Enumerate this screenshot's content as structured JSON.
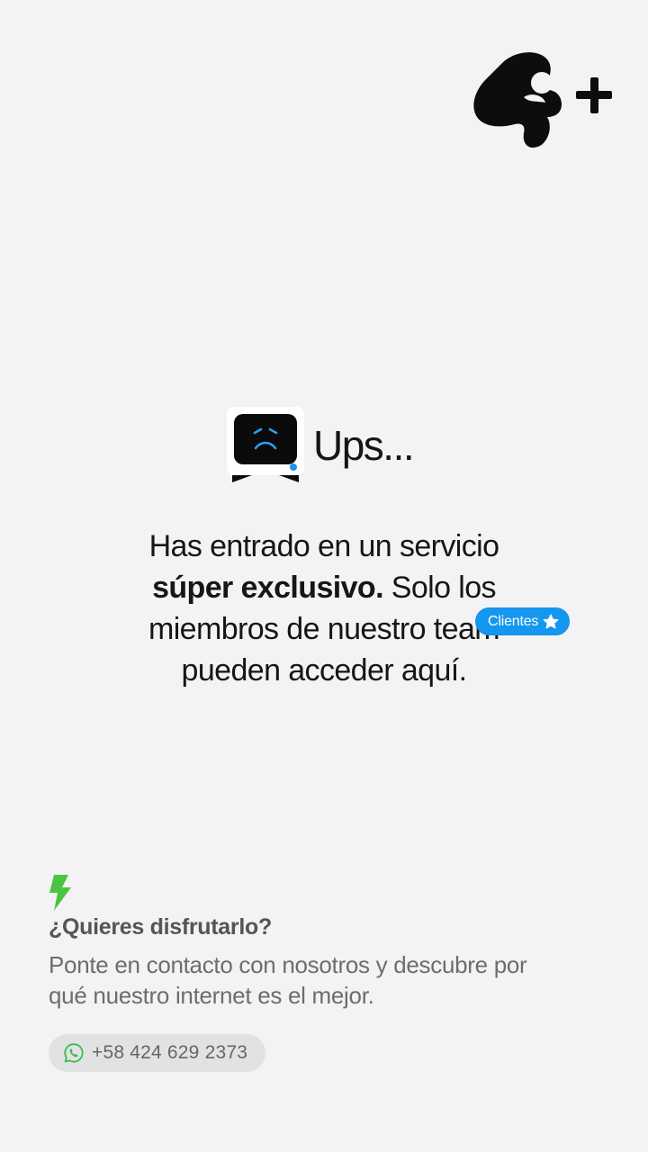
{
  "brand": {
    "logo_icon": "brand-logo-4-plus"
  },
  "hero": {
    "heading": "Ups...",
    "icon": "sad-tv-icon",
    "message": {
      "line1": "Has entrado en un servicio",
      "line2_bold": "súper exclusivo.",
      "line2_rest": " Solo los",
      "line3": "miembros de nuestro team",
      "line4": "pueden acceder aquí."
    },
    "badge": {
      "label": "Clientes",
      "icon": "star-icon"
    }
  },
  "contact": {
    "icon": "lightning-bolt-icon",
    "title": "¿Quieres disfrutarlo?",
    "description": "Ponte en contacto con nosotros y descubre por qué nuestro internet es el mejor.",
    "phone": {
      "icon": "whatsapp-icon",
      "number": "+58 424 629 2373"
    }
  },
  "colors": {
    "background": "#f3f3f5",
    "accent_blue": "#1597f0",
    "bolt_green": "#4cc341",
    "text_dark": "#161616",
    "text_muted": "#6d6d6d"
  }
}
